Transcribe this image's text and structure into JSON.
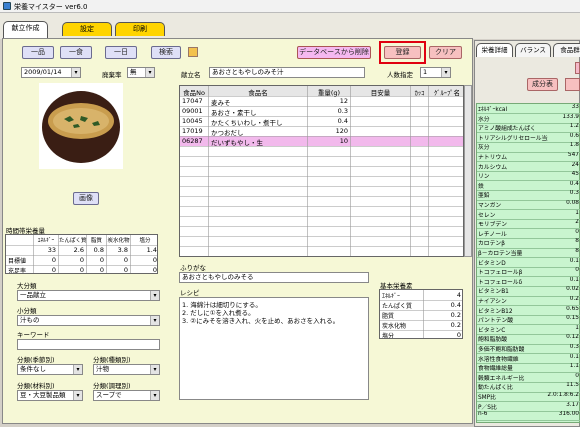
{
  "window": {
    "title": "栄養マイスター ver6.0"
  },
  "tabs": [
    {
      "label": "献立作成"
    },
    {
      "label": "設定"
    },
    {
      "label": "印刷"
    }
  ],
  "toolbar": {
    "btn1": "一品",
    "btn2": "一食",
    "btn3": "一日",
    "search": "検索",
    "db_delete": "データベースから削除",
    "register": "登録",
    "clear": "クリア"
  },
  "date": {
    "value": "2009/01/14"
  },
  "waste": {
    "label": "廃棄率",
    "value": "無"
  },
  "menu": {
    "label": "献立名",
    "value": "あおさともやしのみそ汁"
  },
  "servings": {
    "label": "人数指定",
    "value": "1"
  },
  "image_button": "画像",
  "ingredients": {
    "headers": [
      "食品No",
      "食品名",
      "重量(g)",
      "目安量",
      "ｶｯｺ",
      "ｸﾞﾙｰﾌﾟ名"
    ],
    "rows": [
      {
        "no": "17047",
        "name": "麦みそ",
        "weight": "12"
      },
      {
        "no": "09001",
        "name": "あおさ・素干し",
        "weight": "0.3"
      },
      {
        "no": "10045",
        "name": "かたくちいわし・煮干し",
        "weight": "0.4"
      },
      {
        "no": "17019",
        "name": "かつおだし",
        "weight": "120"
      },
      {
        "no": "06287",
        "name": "だいずもやし・生",
        "weight": "10",
        "selected": true
      }
    ]
  },
  "time_table": {
    "title": "時間帯栄養量",
    "headers": [
      "ｴﾈﾙｷﾞｰ",
      "たんぱく質",
      "脂質",
      "炭水化物",
      "塩分"
    ],
    "rows": [
      {
        "label": "",
        "values": [
          "33",
          "2.6",
          "0.8",
          "3.8",
          "1.4"
        ]
      },
      {
        "label": "目標値",
        "values": [
          "0",
          "0",
          "0",
          "0",
          "0"
        ]
      },
      {
        "label": "充足率",
        "values": [
          "0",
          "0",
          "0",
          "0",
          "0"
        ]
      }
    ]
  },
  "class_large": {
    "label": "大分類",
    "value": "一品献立"
  },
  "class_small": {
    "label": "小分類",
    "value": "汁もの"
  },
  "keyword": {
    "label": "キーワード",
    "value": ""
  },
  "class_season": {
    "label": "分類(季節別)",
    "value": "条件なし"
  },
  "class_type": {
    "label": "分類(種類別)",
    "value": "汁物"
  },
  "class_material": {
    "label": "分類(材料別)",
    "value": "豆・大豆製品類"
  },
  "class_cook": {
    "label": "分類(調理別)",
    "value": "スープで"
  },
  "furigana": {
    "label": "ふりがな",
    "value": "あおさともやしのみそる"
  },
  "recipe": {
    "label": "レシピ",
    "lines": [
      "1. 海綿汁は細切りにする。",
      "2. だしに①を入れ煮る。",
      "3. ②にみそを溶き入れ、火を止め、あおさを入れる。"
    ]
  },
  "basic_nutr": {
    "label": "基本栄養素",
    "rows": [
      {
        "name": "ｴﾈﾙｷﾞｰ",
        "value": "4"
      },
      {
        "name": "たんぱく質",
        "value": "0.4"
      },
      {
        "name": "脂質",
        "value": "0.2"
      },
      {
        "name": "炭水化物",
        "value": "0.2"
      },
      {
        "name": "塩分",
        "value": "0"
      }
    ]
  },
  "right": {
    "tabs": [
      "栄養詳細",
      "バランス",
      "食品群"
    ],
    "btn": "成分表",
    "nutrients": [
      {
        "name": "ｴﾈﾙｷﾞｰkcal",
        "value": "33"
      },
      {
        "name": "水分",
        "value": "133.9"
      },
      {
        "name": "アミノ酸組成たんぱく",
        "value": "1.2"
      },
      {
        "name": "トリアシルグリセロール当量",
        "value": "0.6"
      },
      {
        "name": "灰分",
        "value": "1.8"
      },
      {
        "name": "ナトリウム",
        "value": "547"
      },
      {
        "name": "カルシウム",
        "value": "24"
      },
      {
        "name": "リン",
        "value": "45"
      },
      {
        "name": "鉄",
        "value": "0.4"
      },
      {
        "name": "亜鉛",
        "value": "0.3"
      },
      {
        "name": "マンガン",
        "value": "0.08"
      },
      {
        "name": "セレン",
        "value": "1"
      },
      {
        "name": "モリブデン",
        "value": "2"
      },
      {
        "name": "レチノール",
        "value": "0"
      },
      {
        "name": "カロテンβ",
        "value": "8"
      },
      {
        "name": "β－カロテン当量",
        "value": "8"
      },
      {
        "name": "ビタミンD",
        "value": "0.1"
      },
      {
        "name": "トコフェロールβ",
        "value": "0"
      },
      {
        "name": "トコフェロールδ",
        "value": "0.1"
      },
      {
        "name": "ビタミンB1",
        "value": "0.02"
      },
      {
        "name": "ナイアシン",
        "value": "0.2"
      },
      {
        "name": "ビタミンB12",
        "value": "0.65"
      },
      {
        "name": "パントテン酸",
        "value": "0.15"
      },
      {
        "name": "ビタミンC",
        "value": "1"
      },
      {
        "name": "飽和脂肪酸",
        "value": "0.12"
      },
      {
        "name": "多価不飽和脂肪酸",
        "value": "0.3"
      },
      {
        "name": "水溶性食物繊維",
        "value": "0.1"
      },
      {
        "name": "食物繊維総量",
        "value": "1.1"
      },
      {
        "name": "穀類エネルギー比",
        "value": "0"
      },
      {
        "name": "動たんぱく比",
        "value": "11.5"
      },
      {
        "name": "SMP比",
        "value": "2.0:1.8:6.2"
      },
      {
        "name": "P／S比",
        "value": "3.17"
      },
      {
        "name": "n-6",
        "value": "316.00"
      }
    ]
  }
}
